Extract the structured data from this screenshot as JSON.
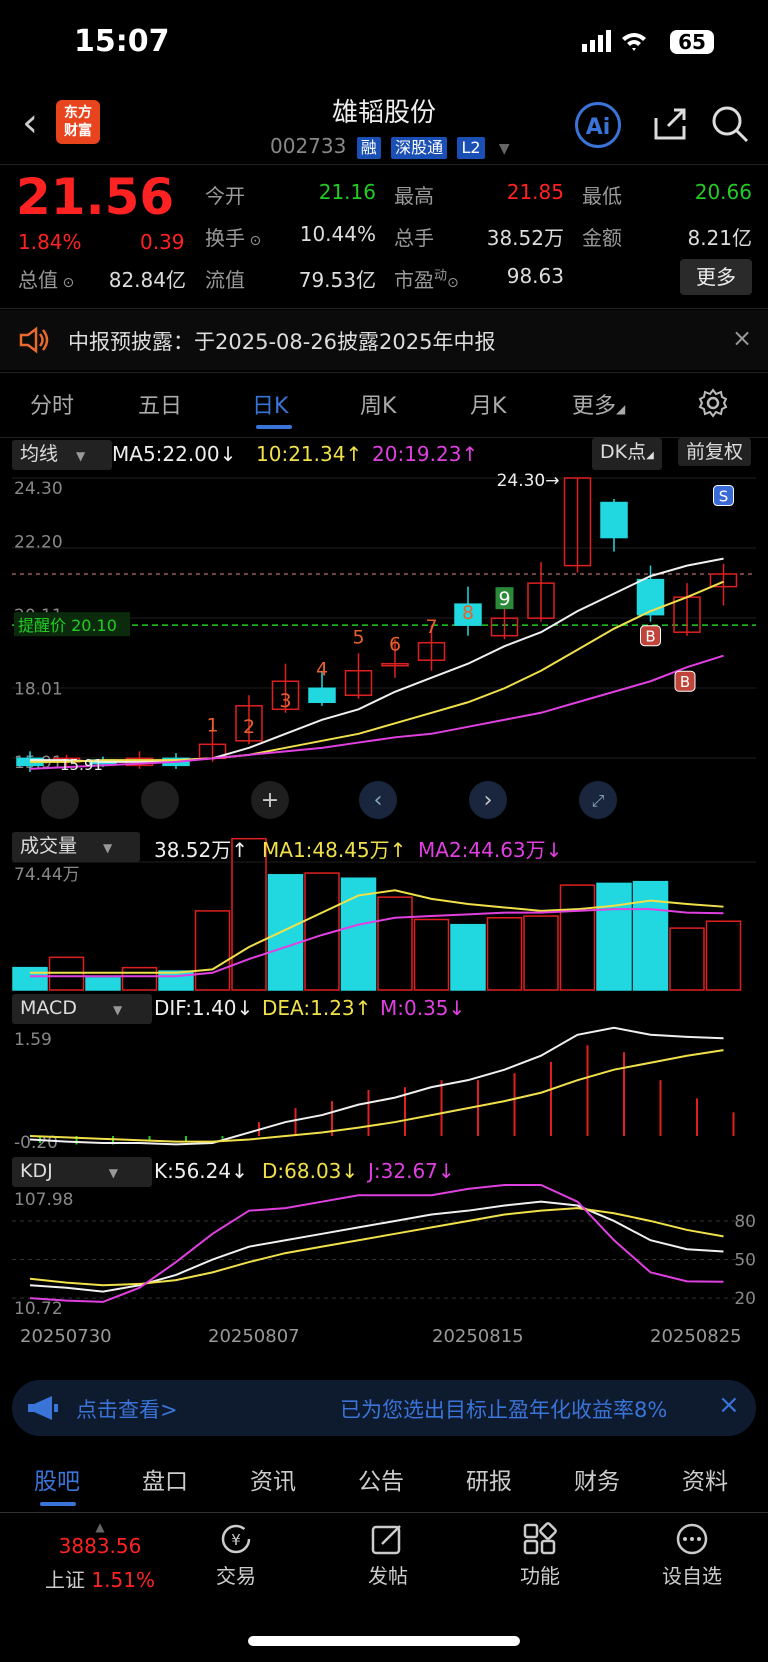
{
  "status": {
    "time": "15:07",
    "battery": "65"
  },
  "header": {
    "name": "雄韬股份",
    "code": "002733",
    "tags": [
      "融",
      "深股通",
      "L2"
    ],
    "logo": "东方\n财富",
    "ai": "Ai"
  },
  "quote": {
    "price": "21.56",
    "pct": "1.84%",
    "change": "0.39",
    "open_lbl": "今开",
    "open": "21.16",
    "high_lbl": "最高",
    "high": "21.85",
    "low_lbl": "最低",
    "low": "20.66",
    "turnover_lbl": "换手",
    "turnover": "10.44%",
    "volume_lbl": "总手",
    "volume": "38.52万",
    "amount_lbl": "金额",
    "amount": "8.21亿",
    "mcap_lbl": "总值",
    "mcap": "82.84亿",
    "float_lbl": "流值",
    "float": "79.53亿",
    "pe_lbl": "市盈",
    "pe_sup": "动",
    "pe": "98.63",
    "more": "更多"
  },
  "notice": {
    "label": "中报预披露：",
    "text": "于2025-08-26披露2025年中报"
  },
  "tabs": [
    "分时",
    "五日",
    "日K",
    "周K",
    "月K",
    "更多"
  ],
  "kline_bar": {
    "ma_btn": "均线",
    "ma5": "MA5:22.00↓",
    "ma10": "10:21.34↑",
    "ma20": "20:19.23↑",
    "dk": "DK点",
    "fq": "前复权"
  },
  "vol_bar": {
    "btn": "成交量",
    "v": "38.52万↑",
    "ma1": "MA1:48.45万↑",
    "ma2": "MA2:44.63万↓"
  },
  "macd_bar": {
    "btn": "MACD",
    "dif": "DIF:1.40↓",
    "dea": "DEA:1.23↑",
    "m": "M:0.35↓"
  },
  "kdj_bar": {
    "btn": "KDJ",
    "k": "K:56.24↓",
    "d": "D:68.03↓",
    "j": "J:32.67↓"
  },
  "chart_data": {
    "type": "candlestick",
    "dates_axis": [
      "20250730",
      "20250807",
      "20250815",
      "20250825"
    ],
    "price_ticks": [
      "24.30",
      "22.20",
      "20.11",
      "18.01",
      "15.91"
    ],
    "alert_price": "提醒价 20.10",
    "alert_value": 20.1,
    "max_label": "24.30→",
    "min_label": "15.91",
    "ylim": [
      15.91,
      24.3
    ],
    "candles": [
      {
        "o": 16.1,
        "c": 16.3,
        "h": 16.5,
        "l": 15.91,
        "up": false
      },
      {
        "o": 16.2,
        "c": 16.3,
        "h": 16.4,
        "l": 16.05,
        "up": true
      },
      {
        "o": 16.25,
        "c": 16.15,
        "h": 16.35,
        "l": 16.05,
        "up": false
      },
      {
        "o": 16.1,
        "c": 16.3,
        "h": 16.5,
        "l": 16.0,
        "up": true
      },
      {
        "o": 16.1,
        "c": 16.3,
        "h": 16.45,
        "l": 16.0,
        "up": false
      },
      {
        "o": 16.3,
        "c": 16.7,
        "h": 17.2,
        "l": 16.2,
        "up": true
      },
      {
        "o": 16.8,
        "c": 17.8,
        "h": 18.1,
        "l": 16.7,
        "up": true
      },
      {
        "o": 17.7,
        "c": 18.5,
        "h": 19.0,
        "l": 17.6,
        "up": true
      },
      {
        "o": 18.3,
        "c": 17.9,
        "h": 18.8,
        "l": 17.8,
        "up": false
      },
      {
        "o": 18.1,
        "c": 18.8,
        "h": 19.3,
        "l": 18.0,
        "up": true
      },
      {
        "o": 19.0,
        "c": 19.0,
        "h": 19.7,
        "l": 18.6,
        "up": true
      },
      {
        "o": 19.1,
        "c": 19.6,
        "h": 20.1,
        "l": 18.8,
        "up": true
      },
      {
        "o": 20.1,
        "c": 20.7,
        "h": 21.2,
        "l": 19.8,
        "up": false
      },
      {
        "o": 19.8,
        "c": 20.3,
        "h": 20.8,
        "l": 19.7,
        "up": true
      },
      {
        "o": 20.3,
        "c": 21.3,
        "h": 21.9,
        "l": 20.2,
        "up": true
      },
      {
        "o": 21.8,
        "c": 24.3,
        "h": 24.3,
        "l": 21.6,
        "up": true
      },
      {
        "o": 23.6,
        "c": 22.6,
        "h": 23.7,
        "l": 22.2,
        "up": false
      },
      {
        "o": 21.4,
        "c": 20.4,
        "h": 21.8,
        "l": 20.2,
        "up": false
      },
      {
        "o": 19.9,
        "c": 20.9,
        "h": 21.3,
        "l": 19.8,
        "up": true
      },
      {
        "o": 21.2,
        "c": 21.56,
        "h": 21.85,
        "l": 20.66,
        "up": true
      }
    ],
    "ma5": [
      16.25,
      16.25,
      16.2,
      16.2,
      16.25,
      16.3,
      16.6,
      17.0,
      17.4,
      17.7,
      18.2,
      18.6,
      19.0,
      19.5,
      19.9,
      20.5,
      21.0,
      21.5,
      21.8,
      22.0
    ],
    "ma10": [
      16.2,
      16.2,
      16.25,
      16.25,
      16.25,
      16.3,
      16.4,
      16.6,
      16.8,
      17.0,
      17.3,
      17.6,
      17.9,
      18.3,
      18.8,
      19.4,
      20.0,
      20.5,
      20.9,
      21.34
    ],
    "ma20": [
      16.0,
      16.05,
      16.1,
      16.15,
      16.2,
      16.3,
      16.4,
      16.5,
      16.6,
      16.75,
      16.9,
      17.0,
      17.2,
      17.4,
      17.6,
      17.9,
      18.2,
      18.5,
      18.9,
      19.23
    ],
    "marks_top": [
      "1",
      "2",
      "3",
      "4",
      "5",
      "6",
      "7",
      "8",
      "9"
    ],
    "vol_max": "74.44万",
    "vol": [
      13,
      19,
      7,
      13,
      11,
      46,
      88,
      67,
      68,
      65,
      54,
      41,
      38,
      42,
      43,
      61,
      62,
      63,
      36,
      40
    ],
    "vol_up": [
      false,
      true,
      false,
      true,
      false,
      true,
      true,
      false,
      true,
      false,
      true,
      true,
      false,
      true,
      true,
      true,
      false,
      false,
      true,
      true
    ],
    "vma1": [
      10,
      10,
      10,
      10,
      10,
      12,
      25,
      35,
      45,
      55,
      58,
      53,
      50,
      48,
      46,
      47,
      49,
      52,
      50,
      48.45
    ],
    "vma2": [
      8,
      8,
      8,
      8,
      8,
      10,
      18,
      25,
      32,
      38,
      42,
      43,
      44,
      45,
      45,
      46,
      47,
      47,
      45,
      44.63
    ],
    "macd_max": "1.59",
    "macd_min": "-0.20",
    "dif": [
      -0.05,
      -0.08,
      -0.1,
      -0.1,
      -0.12,
      -0.1,
      0.05,
      0.2,
      0.3,
      0.45,
      0.55,
      0.7,
      0.8,
      0.95,
      1.15,
      1.45,
      1.55,
      1.45,
      1.42,
      1.4
    ],
    "dea": [
      0.0,
      -0.02,
      -0.04,
      -0.06,
      -0.08,
      -0.08,
      -0.05,
      0.0,
      0.05,
      0.12,
      0.2,
      0.3,
      0.4,
      0.5,
      0.62,
      0.8,
      0.95,
      1.05,
      1.15,
      1.23
    ],
    "kdj_max": "107.98",
    "kdj_min": "10.72",
    "kdj_ticks": [
      "80",
      "50",
      "20"
    ],
    "k": [
      30,
      28,
      25,
      30,
      38,
      50,
      60,
      65,
      70,
      75,
      80,
      85,
      88,
      92,
      95,
      92,
      80,
      65,
      58,
      56.24
    ],
    "d": [
      35,
      32,
      30,
      31,
      34,
      40,
      48,
      55,
      60,
      65,
      70,
      75,
      80,
      85,
      88,
      90,
      86,
      80,
      73,
      68.03
    ],
    "j": [
      20,
      18,
      17,
      28,
      48,
      70,
      88,
      90,
      95,
      100,
      100,
      100,
      105,
      108,
      108,
      95,
      65,
      40,
      33,
      32.67
    ]
  },
  "ad": {
    "left": "点击查看>",
    "right": "已为您选出目标止盈年化收益率8%"
  },
  "bottom_tabs": [
    "股吧",
    "盘口",
    "资讯",
    "公告",
    "研报",
    "财务",
    "资料"
  ],
  "dock": {
    "index_value": "3883.56",
    "index_name": "上证",
    "index_pct": "1.51%",
    "trade": "交易",
    "post": "发帖",
    "func": "功能",
    "watch": "设自选"
  }
}
